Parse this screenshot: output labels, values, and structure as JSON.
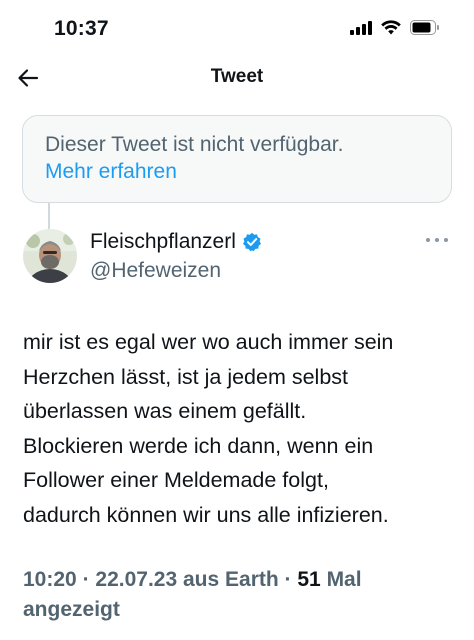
{
  "status_bar": {
    "time": "10:37"
  },
  "nav": {
    "title": "Tweet",
    "back_icon": "arrow-left-icon"
  },
  "unavailable": {
    "message": "Dieser Tweet ist nicht verfügbar.",
    "link": "Mehr erfahren"
  },
  "tweet": {
    "author_name": "Fleischpflanzerl",
    "author_handle": "@Hefeweizen",
    "verified": true,
    "text": "mir ist es egal wer wo auch immer sein\nHerzchen lässt, ist ja jedem selbst\nüberlassen was einem gefällt.\nBlockieren werde ich dann, wenn ein\nFollower einer Meldemade folgt,\ndadurch können wir uns alle infizieren.",
    "time": "10:20",
    "date": "22.07.23",
    "source": "aus Earth",
    "views_count": "51",
    "views_label_1": "Mal",
    "views_label_2": "angezeigt"
  },
  "colors": {
    "accent": "#1d9bf0",
    "secondary_text": "#536471",
    "primary_text": "#0f1419",
    "box_background": "#f7f9f9"
  }
}
